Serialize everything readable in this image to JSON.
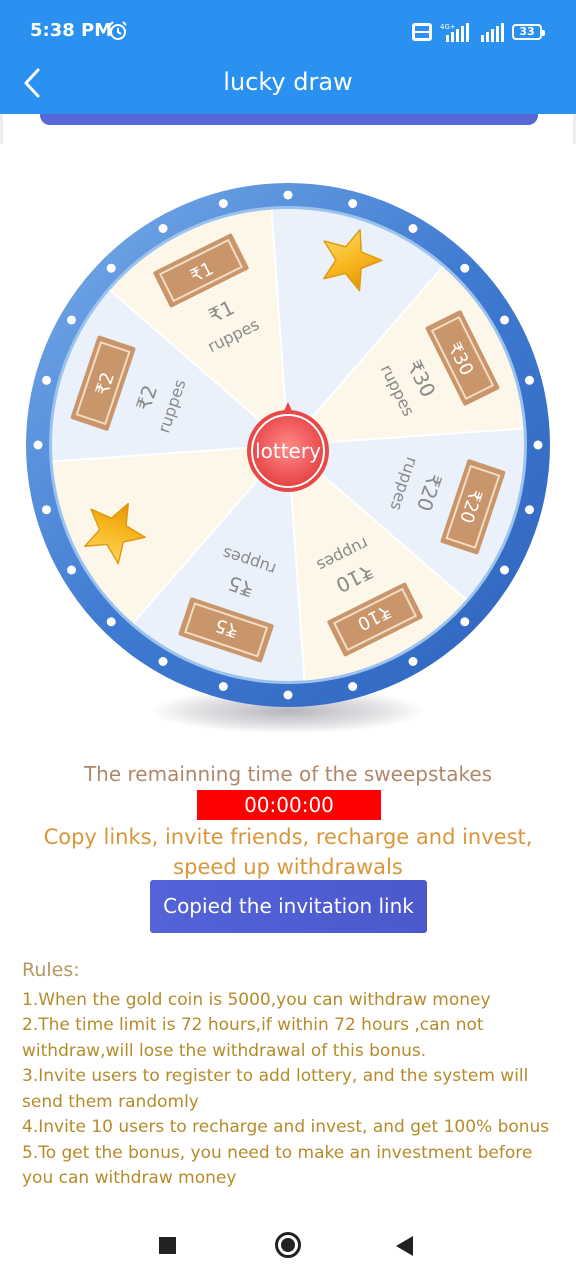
{
  "status_bar": {
    "time": "5:38 PM",
    "network": "4G+",
    "volte": "Vo LTE",
    "battery": "33"
  },
  "header": {
    "title": "lucky draw",
    "back_icon": "chevron-left-icon",
    "color": "#2b91f0"
  },
  "wheel": {
    "center_label": "lottery",
    "segments": [
      {
        "type": "star"
      },
      {
        "type": "cash",
        "note": "₹30",
        "amount": "₹30",
        "unit": "ruppes"
      },
      {
        "type": "cash",
        "note": "₹20",
        "amount": "₹20",
        "unit": "ruppes"
      },
      {
        "type": "cash",
        "note": "₹10",
        "amount": "₹10",
        "unit": "ruppes"
      },
      {
        "type": "cash",
        "note": "₹5",
        "amount": "₹5",
        "unit": "ruppes"
      },
      {
        "type": "star"
      },
      {
        "type": "cash",
        "note": "₹2",
        "amount": "₹2",
        "unit": "ruppes"
      },
      {
        "type": "cash",
        "note": "₹1",
        "amount": "₹1",
        "unit": "ruppes"
      }
    ],
    "ring_color": "#4a84d6",
    "center_color": "#ec5353"
  },
  "sweepstakes": {
    "remaining_title": "The remainning time of the sweepstakes",
    "timer": "00:00:00",
    "invite_text": "Copy links, invite friends, recharge and invest, speed up withdrawals",
    "copy_button": "Copied the invitation link"
  },
  "rules": {
    "heading": "Rules:",
    "items": [
      "1.When the gold coin is 5000,you can withdraw money",
      "2.The time limit is 72 hours,if within 72 hours ,can not withdraw,will lose the withdrawal of this bonus.",
      "3.Invite users to register to add lottery, and the system will send them randomly",
      "4.Invite 10 users to recharge and invest, and get 100% bonus",
      "5.To get the bonus, you need to make an investment before you can withdraw money"
    ]
  },
  "nav_buttons": [
    "recent-apps",
    "home",
    "back"
  ]
}
